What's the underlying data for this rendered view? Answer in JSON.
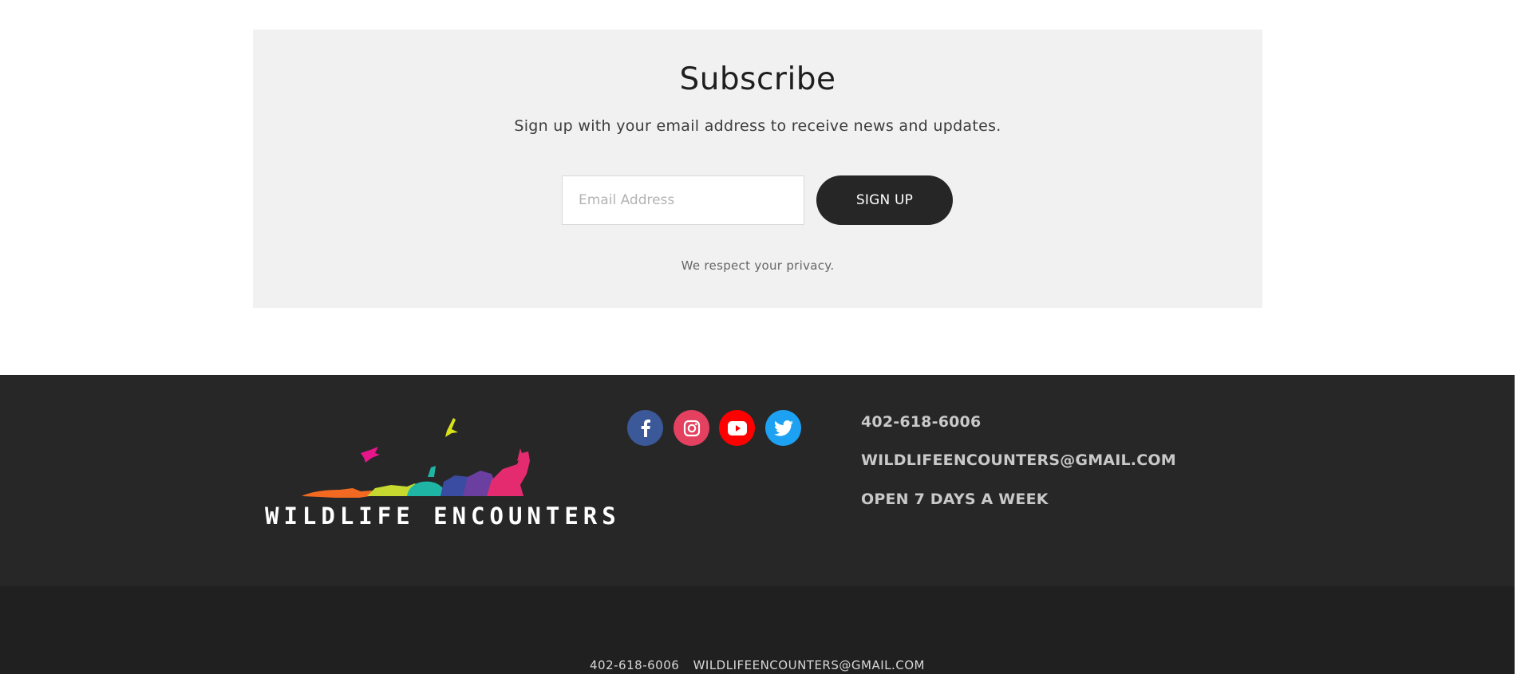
{
  "subscribe": {
    "title": "Subscribe",
    "description": "Sign up with your email address to receive news and updates.",
    "email_placeholder": "Email Address",
    "email_value": "",
    "button_label": "SIGN UP",
    "privacy_note": "We respect your privacy."
  },
  "footer": {
    "logo_text": "WILDLIFE ENCOUNTERS",
    "social": [
      {
        "name": "facebook",
        "icon": "facebook-icon",
        "color": "#3b5998"
      },
      {
        "name": "instagram",
        "icon": "instagram-icon",
        "color": "#e4405f"
      },
      {
        "name": "youtube",
        "icon": "youtube-icon",
        "color": "#ff0000"
      },
      {
        "name": "twitter",
        "icon": "twitter-icon",
        "color": "#1da1f2"
      }
    ],
    "contact": {
      "phone": "402-618-6006",
      "email": "WILDLIFEENCOUNTERS@GMAIL.COM",
      "hours": "OPEN 7 DAYS A WEEK"
    },
    "bottom": {
      "phone": "402-618-6006",
      "email": "WILDLIFEENCOUNTERS@GMAIL.COM"
    }
  },
  "colors": {
    "subscribe_bg": "#f1f1f1",
    "button_bg": "#262626",
    "footer_bg": "#272727",
    "footer_bottom_bg": "#202020"
  }
}
